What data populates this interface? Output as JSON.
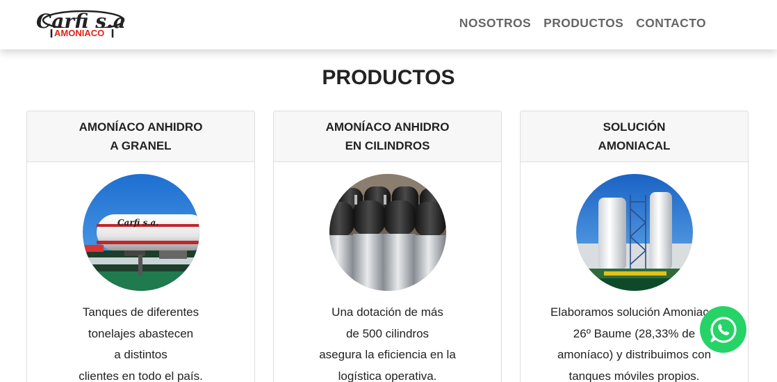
{
  "header": {
    "logo": {
      "name": "Carfi s.a.",
      "sub": "AMONIACO"
    },
    "nav": [
      "NOSOTROS",
      "PRODUCTOS",
      "CONTACTO"
    ]
  },
  "section": {
    "title": "PRODUCTOS"
  },
  "cards": [
    {
      "title": [
        "AMONÍACO ANHIDRO",
        "A GRANEL"
      ],
      "image": "ammonia-tank-truck",
      "text": [
        "Tanques de diferentes",
        "tonelajes abastecen",
        "a distintos",
        "clientes en todo el país."
      ]
    },
    {
      "title": [
        "AMONÍACO ANHIDRO",
        "EN CILINDROS"
      ],
      "image": "gas-cylinders",
      "text": [
        "Una dotación de más",
        "de 500 cilindros",
        "asegura la eficiencia en la",
        "logística operativa."
      ]
    },
    {
      "title": [
        "SOLUCIÓN",
        "AMONIACAL"
      ],
      "image": "storage-silos",
      "text": [
        "Elaboramos solución Amoniacal",
        "26º Baume (28,33% de",
        "amoníaco) y distribuimos con",
        "tanques móviles propios."
      ]
    }
  ],
  "colors": {
    "nav_text": "#666666",
    "brand_red": "#e0241b",
    "whatsapp_green": "#25d366"
  },
  "floating": {
    "icon": "whatsapp-icon"
  }
}
